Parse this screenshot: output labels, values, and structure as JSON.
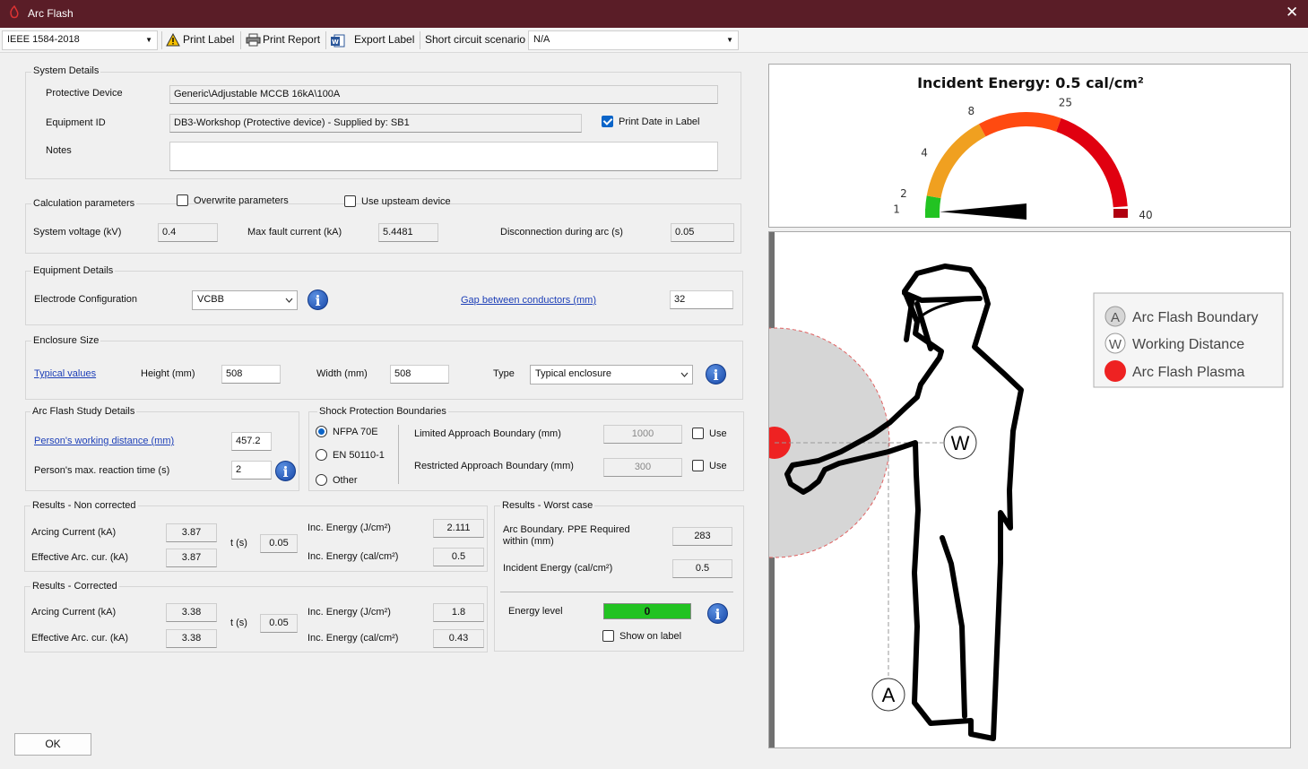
{
  "window": {
    "title": "Arc Flash",
    "close_glyph": "✕"
  },
  "toolbar": {
    "standard": "IEEE 1584-2018",
    "print_label": "Print Label",
    "print_report": "Print Report",
    "export_label": "Export Label",
    "scenario_label": "Short circuit scenario",
    "scenario_value": "N/A",
    "icons": [
      "warning-icon",
      "printer-icon",
      "word-icon"
    ]
  },
  "system_details": {
    "title": "System Details",
    "protective_device_label": "Protective Device",
    "protective_device_value": "Generic\\Adjustable MCCB 16kA\\100A",
    "equipment_id_label": "Equipment ID",
    "equipment_id_value": "DB3-Workshop  (Protective device) - Supplied by: SB1",
    "print_date_label": "Print Date in Label",
    "print_date_checked": true,
    "notes_label": "Notes",
    "notes_value": ""
  },
  "calc": {
    "title": "Calculation parameters",
    "overwrite_label": "Overwrite parameters",
    "upstream_label": "Use upsteam device",
    "voltage_label": "System voltage (kV)",
    "voltage_value": "0.4",
    "fault_label": "Max fault current (kA)",
    "fault_value": "5.4481",
    "disconnect_label": "Disconnection during arc (s)",
    "disconnect_value": "0.05"
  },
  "equipment": {
    "title": "Equipment Details",
    "electrode_label": "Electrode Configuration",
    "electrode_value": "VCBB",
    "gap_label": "Gap between conductors (mm)",
    "gap_value": "32"
  },
  "enclosure": {
    "title": "Enclosure Size",
    "typical_link": "Typical values",
    "height_label": "Height (mm)",
    "height_value": "508",
    "width_label": "Width (mm)",
    "width_value": "508",
    "type_label": "Type",
    "type_value": "Typical enclosure"
  },
  "study": {
    "title": "Arc Flash Study Details",
    "distance_link": "Person's working distance (mm)",
    "distance_value": "457.2",
    "reaction_label": "Person's max. reaction time (s)",
    "reaction_value": "2"
  },
  "shock": {
    "title": "Shock Protection Boundaries",
    "options": [
      "NFPA 70E",
      "EN 50110-1",
      "Other"
    ],
    "limited_label": "Limited Approach Boundary (mm)",
    "limited_value": "1000",
    "restricted_label": "Restricted Approach Boundary (mm)",
    "restricted_value": "300",
    "use_label": "Use"
  },
  "results_nc": {
    "title": "Results - Non corrected",
    "arcing_label": "Arcing Current (kA)",
    "arcing_value": "3.87",
    "eff_label": "Effective Arc. cur. (kA)",
    "eff_value": "3.87",
    "t_label": "t (s)",
    "t_value": "0.05",
    "inc_j_label": "Inc. Energy (J/cm²)",
    "inc_j_value": "2.111",
    "inc_cal_label": "Inc. Energy (cal/cm²)",
    "inc_cal_value": "0.5"
  },
  "results_c": {
    "title": "Results - Corrected",
    "arcing_label": "Arcing Current (kA)",
    "arcing_value": "3.38",
    "eff_label": "Effective Arc. cur. (kA)",
    "eff_value": "3.38",
    "t_label": "t (s)",
    "t_value": "0.05",
    "inc_j_label": "Inc. Energy (J/cm²)",
    "inc_j_value": "1.8",
    "inc_cal_label": "Inc. Energy (cal/cm²)",
    "inc_cal_value": "0.43"
  },
  "worst": {
    "title": "Results - Worst case",
    "boundary_label_1": "Arc Boundary. PPE Required",
    "boundary_label_2": "within (mm)",
    "boundary_value": "283",
    "incident_label": "Incident Energy (cal/cm²)",
    "incident_value": "0.5",
    "energy_label": "Energy level",
    "energy_value": "0",
    "energy_color": "#22c322",
    "show_label": "Show on label"
  },
  "gauge": {
    "title": "Incident Energy: 0.5 cal/cm²",
    "value": 0.5,
    "tick_labels": [
      "1",
      "2",
      "4",
      "8",
      "25",
      "40"
    ],
    "zone_colors": [
      "#22c322",
      "#f0a020",
      "#ff4a10",
      "#e00010"
    ]
  },
  "diagram": {
    "legend": [
      {
        "letter": "A",
        "label": "Arc Flash Boundary"
      },
      {
        "letter": "W",
        "label": "Working Distance"
      },
      {
        "letter": "",
        "label": "Arc Flash Plasma"
      }
    ],
    "marker_w": "W",
    "marker_a": "A",
    "plasma_color": "#ee2222"
  },
  "ok_button": "OK"
}
